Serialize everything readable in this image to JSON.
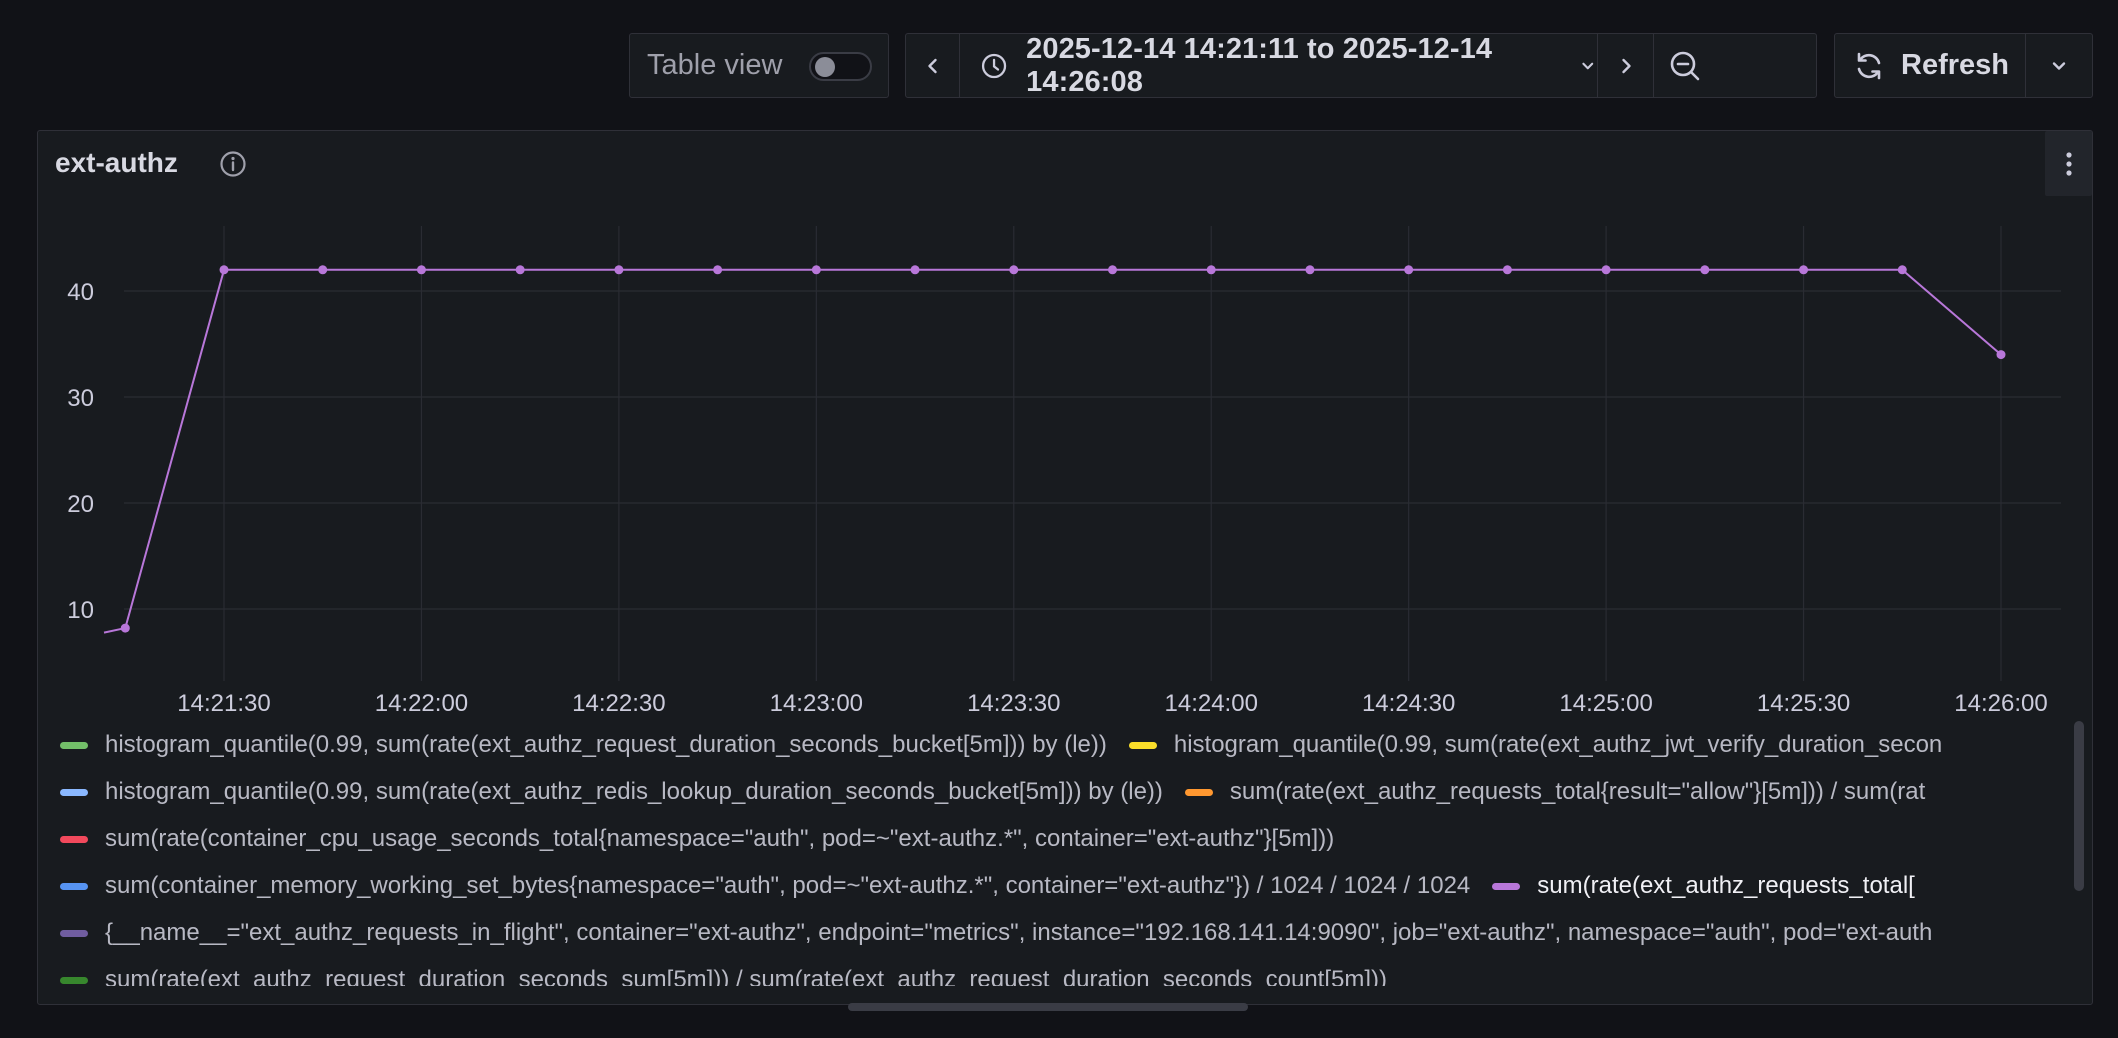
{
  "toolbar": {
    "table_view_label": "Table view",
    "time_range": "2025-12-14 14:21:11 to 2025-12-14 14:26:08",
    "refresh_label": "Refresh"
  },
  "panel": {
    "title": "ext-authz"
  },
  "chart_data": {
    "type": "line",
    "title": "ext-authz",
    "x": [
      "14:21:00",
      "14:21:15",
      "14:21:30",
      "14:21:45",
      "14:22:00",
      "14:22:15",
      "14:22:30",
      "14:22:45",
      "14:23:00",
      "14:23:15",
      "14:23:30",
      "14:23:45",
      "14:24:00",
      "14:24:15",
      "14:24:30",
      "14:24:45",
      "14:25:00",
      "14:25:15",
      "14:25:30",
      "14:25:45",
      "14:26:00"
    ],
    "x_ticks": [
      "14:21:30",
      "14:22:00",
      "14:22:30",
      "14:23:00",
      "14:23:30",
      "14:24:00",
      "14:24:30",
      "14:25:00",
      "14:25:30",
      "14:26:00"
    ],
    "y_ticks": [
      10,
      20,
      30,
      40
    ],
    "ylim": [
      4,
      47
    ],
    "series": [
      {
        "name": "sum(rate(ext_authz_requests_total[",
        "color": "#b877d9",
        "values": [
          6.2,
          8.2,
          42,
          42,
          42,
          42,
          42,
          42,
          42,
          42,
          42,
          42,
          42,
          42,
          42,
          42,
          42,
          42,
          42,
          42,
          34
        ]
      }
    ],
    "grid": true,
    "legend_position": "bottom"
  },
  "legend": {
    "rows": [
      [
        {
          "color": "#73bf69",
          "text": "histogram_quantile(0.99, sum(rate(ext_authz_request_duration_seconds_bucket[5m])) by (le))"
        },
        {
          "color": "#fade2a",
          "text": "histogram_quantile(0.99, sum(rate(ext_authz_jwt_verify_duration_secon"
        }
      ],
      [
        {
          "color": "#8ab8ff",
          "text": "histogram_quantile(0.99, sum(rate(ext_authz_redis_lookup_duration_seconds_bucket[5m])) by (le))"
        },
        {
          "color": "#ff9830",
          "text": "sum(rate(ext_authz_requests_total{result=\"allow\"}[5m])) / sum(rat"
        }
      ],
      [
        {
          "color": "#f2495c",
          "text": "sum(rate(container_cpu_usage_seconds_total{namespace=\"auth\", pod=~\"ext-authz.*\", container=\"ext-authz\"}[5m]))"
        }
      ],
      [
        {
          "color": "#5794f2",
          "text": "sum(container_memory_working_set_bytes{namespace=\"auth\", pod=~\"ext-authz.*\", container=\"ext-authz\"}) / 1024 / 1024 / 1024"
        },
        {
          "color": "#b877d9",
          "text": "sum(rate(ext_authz_requests_total[",
          "highlight": true
        }
      ],
      [
        {
          "color": "#705da0",
          "text": "{__name__=\"ext_authz_requests_in_flight\", container=\"ext-authz\", endpoint=\"metrics\", instance=\"192.168.141.14:9090\", job=\"ext-authz\", namespace=\"auth\", pod=\"ext-auth"
        }
      ],
      [
        {
          "color": "#37872d",
          "text": "sum(rate(ext_authz_request_duration_seconds_sum[5m])) / sum(rate(ext_authz_request_duration_seconds_count[5m]))"
        }
      ]
    ]
  },
  "icons": {
    "prev": "chevron-left-icon",
    "clock": "clock-icon",
    "range_dropdown": "chevron-down-icon",
    "next": "chevron-right-icon",
    "zoom_out": "zoom-out-icon",
    "refresh": "refresh-icon",
    "refresh_dropdown": "chevron-down-icon",
    "info": "info-icon",
    "menu": "kebab-menu-icon"
  }
}
